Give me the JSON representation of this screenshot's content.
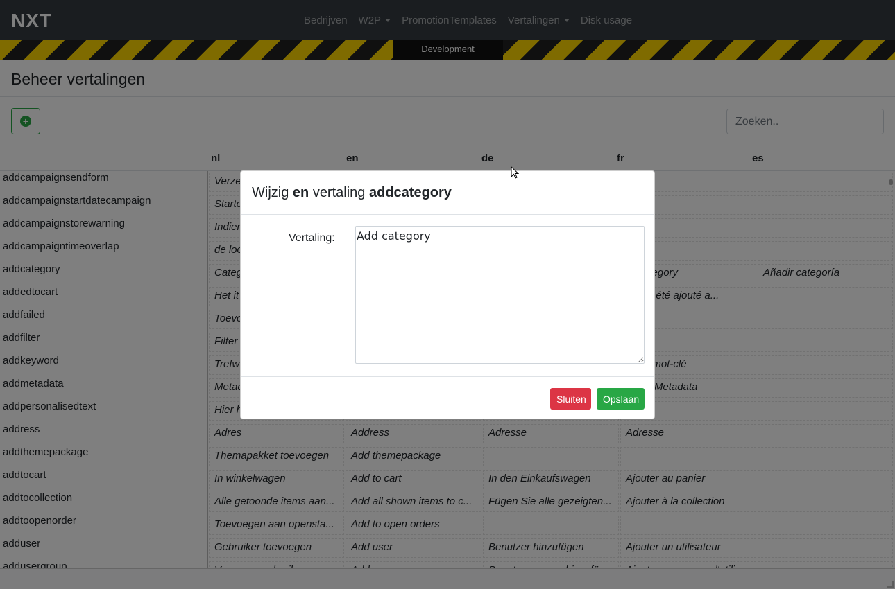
{
  "navbar": {
    "brand": "NXT",
    "items": [
      {
        "label": "Bedrijven",
        "dropdown": false
      },
      {
        "label": "W2P",
        "dropdown": true
      },
      {
        "label": "PromotionTemplates",
        "dropdown": false
      },
      {
        "label": "Vertalingen",
        "dropdown": true
      },
      {
        "label": "Disk usage",
        "dropdown": false
      }
    ]
  },
  "environment": {
    "label": "Development"
  },
  "page": {
    "title": "Beheer vertalingen"
  },
  "toolbar": {
    "add_icon": "plus-circle-icon",
    "search_placeholder": "Zoeken.."
  },
  "table": {
    "columns": [
      "nl",
      "en",
      "de",
      "fr",
      "es"
    ],
    "rows": [
      {
        "key": "addcampaignsendform",
        "nl": "Verze",
        "en": "",
        "de": "",
        "fr": "",
        "es": ""
      },
      {
        "key": "addcampaignstartdatecampaign",
        "nl": "Starto",
        "en": "",
        "de": "",
        "fr": "",
        "es": ""
      },
      {
        "key": "addcampaignstorewarning",
        "nl": "Indier",
        "en": "",
        "de": "",
        "fr": "",
        "es": ""
      },
      {
        "key": "addcampaigntimeoverlap",
        "nl": "de loo",
        "en": "",
        "de": "",
        "fr": "",
        "es": ""
      },
      {
        "key": "addcategory",
        "nl": "Categ",
        "en": "",
        "de": "",
        "fr": "er category",
        "es": "Añadir categoría"
      },
      {
        "key": "addedtocart",
        "nl": "Het it",
        "en": "",
        "de": "",
        "fr": "ticle a été ajouté a...",
        "es": ""
      },
      {
        "key": "addfailed",
        "nl": "Toevo",
        "en": "",
        "de": "",
        "fr": "",
        "es": ""
      },
      {
        "key": "addfilter",
        "nl": "Filter",
        "en": "",
        "de": "",
        "fr": "",
        "es": ""
      },
      {
        "key": "addkeyword",
        "nl": "Trefw",
        "en": "",
        "de": "",
        "fr": "er un mot-clé",
        "es": ""
      },
      {
        "key": "addmetadata",
        "nl": "Metad",
        "en": "",
        "de": "",
        "fr": "er les Metadata",
        "es": ""
      },
      {
        "key": "addpersonalisedtext",
        "nl": "Hier h",
        "en": "",
        "de": "",
        "fr": "",
        "es": ""
      },
      {
        "key": "address",
        "nl": "Adres",
        "en": "Address",
        "de": "Adresse",
        "fr": "Adresse",
        "es": ""
      },
      {
        "key": "addthemepackage",
        "nl": "Themapakket toevoegen",
        "en": "Add themepackage",
        "de": "",
        "fr": "",
        "es": ""
      },
      {
        "key": "addtocart",
        "nl": "In winkelwagen",
        "en": "Add to cart",
        "de": "In den Einkaufswagen",
        "fr": "Ajouter au panier",
        "es": ""
      },
      {
        "key": "addtocollection",
        "nl": "Alle getoonde items aan...",
        "en": "Add all shown items to c...",
        "de": "Fügen Sie alle gezeigten...",
        "fr": "Ajouter à la collection",
        "es": ""
      },
      {
        "key": "addtoopenorder",
        "nl": "Toevoegen aan opensta...",
        "en": "Add to open orders",
        "de": "",
        "fr": "",
        "es": ""
      },
      {
        "key": "adduser",
        "nl": "Gebruiker toevoegen",
        "en": "Add user",
        "de": "Benutzer hinzufügen",
        "fr": "Ajouter un utilisateur",
        "es": ""
      },
      {
        "key": "addusergroup",
        "nl": "Voeg een gebruikersgro...",
        "en": "Add user group",
        "de": "Benutzergruppe hinzufü...",
        "fr": "Ajouter un groupe d'utili...",
        "es": ""
      }
    ]
  },
  "modal": {
    "title_prefix": "Wijzig",
    "language": "en",
    "title_middle": "vertaling",
    "key": "addcategory",
    "field_label": "Vertaling:",
    "value": "Add category",
    "close_label": "Sluiten",
    "save_label": "Opslaan"
  }
}
